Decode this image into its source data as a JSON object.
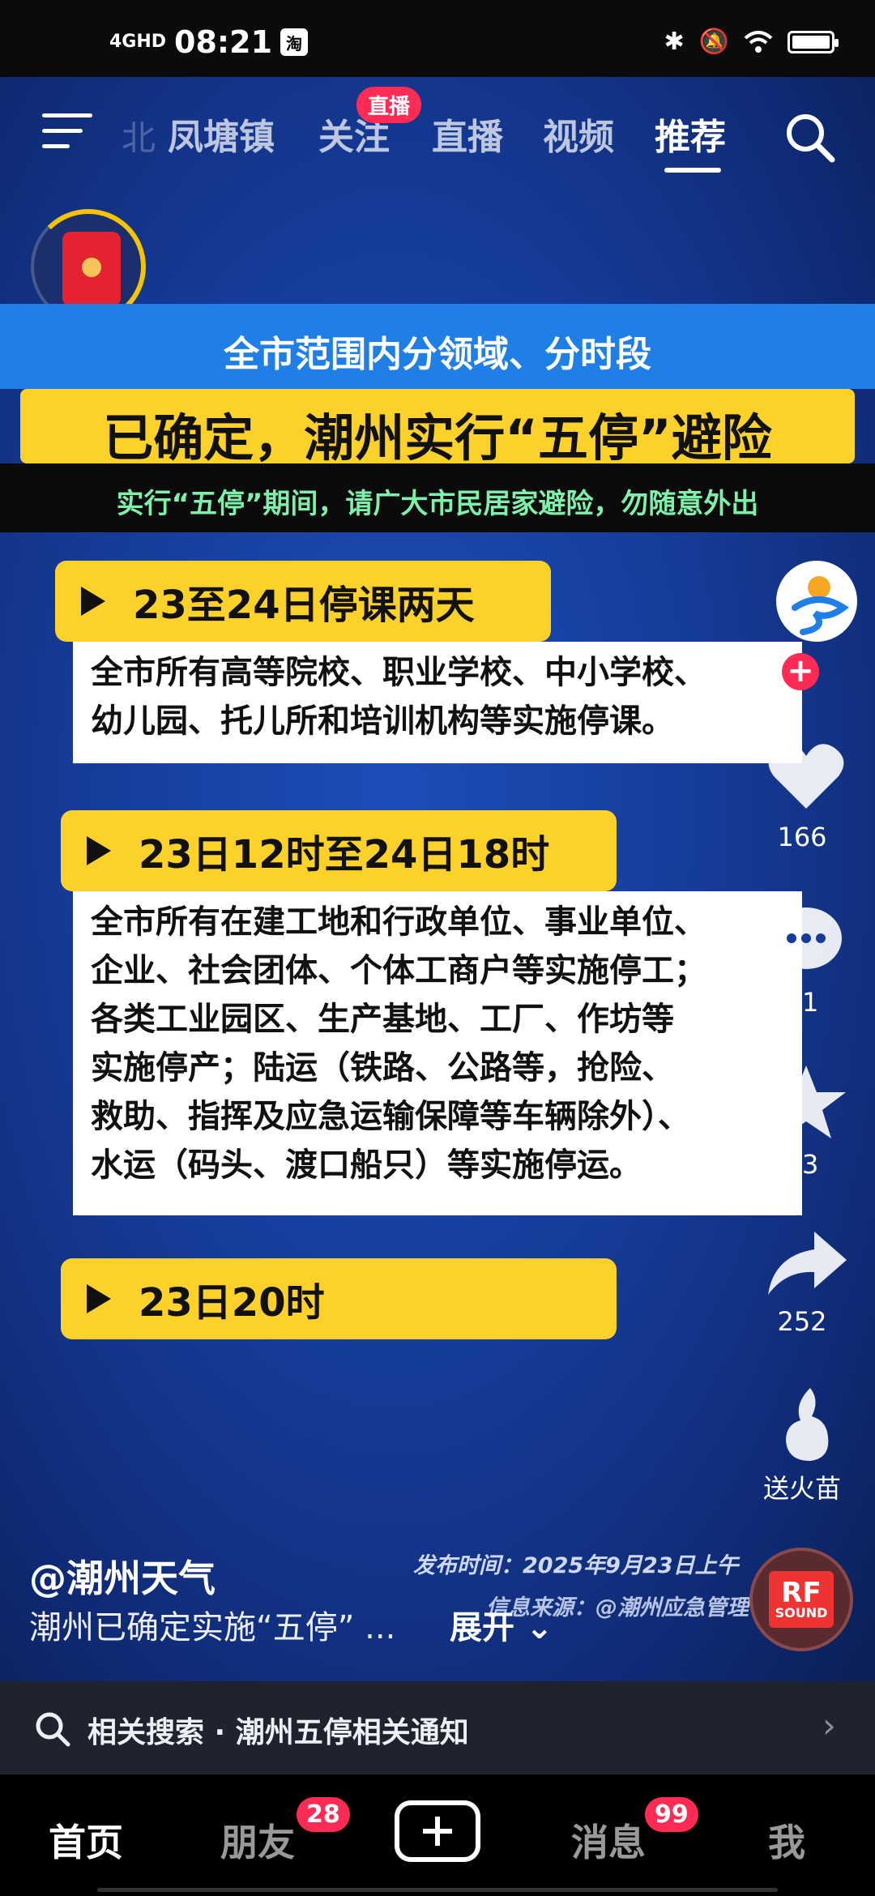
{
  "status_bar": {
    "network": "4GHD",
    "time": "08:21",
    "app_badge": "淘"
  },
  "top_nav": {
    "ghost_tab": "北",
    "tabs": [
      "凤塘镇",
      "关注",
      "直播",
      "视频",
      "推荐"
    ],
    "active_tab": "推荐",
    "live_badge": "直播"
  },
  "video": {
    "headline_sub": "全市范围内分领域、分时段",
    "headline_main": "已确定，潮州实行“五停”避险",
    "notice": "实行“五停”期间，请广大市民居家避险，勿随意外出",
    "sections": [
      {
        "tag": "23至24日停课两天",
        "body": [
          "全市所有高等院校、职业学校、中小学校、",
          "幼儿园、托儿所和培训机构等实施停课。"
        ]
      },
      {
        "tag": "23日12时至24日18时",
        "body": [
          "全市所有在建工地和行政单位、事业单位、",
          "企业、社会团体、个体工商户等实施停工；",
          "各类工业园区、生产基地、工厂、作坊等",
          "实施停产；陆运（铁路、公路等，抢险、",
          "救助、指挥及应急运输保障等车辆除外）、",
          "水运（码头、渡口船只）等实施停运。"
        ]
      },
      {
        "tag": "23日20时"
      }
    ],
    "publish_time": "发布时间：2025年9月23日上午",
    "info_source": "信息来源：@潮州应急管理"
  },
  "right_rail": {
    "likes": "166",
    "comments": "81",
    "favorites": "23",
    "shares": "252",
    "gift_label": "送火苗"
  },
  "caption": {
    "author": "@潮州天气",
    "description": "潮州已确定实施“五停”  ...",
    "expand": "展开"
  },
  "music_disc": {
    "line1": "RF",
    "line2": "SOUND"
  },
  "related_search": {
    "text": "相关搜索 · 潮州五停相关通知"
  },
  "bottom_nav": {
    "home": "首页",
    "friends": "朋友",
    "friends_badge": "28",
    "messages": "消息",
    "messages_badge": "99",
    "me": "我"
  },
  "colors": {
    "accent_red": "#fe2c55",
    "banner_yellow": "#fbd12a",
    "banner_blue": "#1f7fe6",
    "notice_green": "#7ef0a9"
  }
}
